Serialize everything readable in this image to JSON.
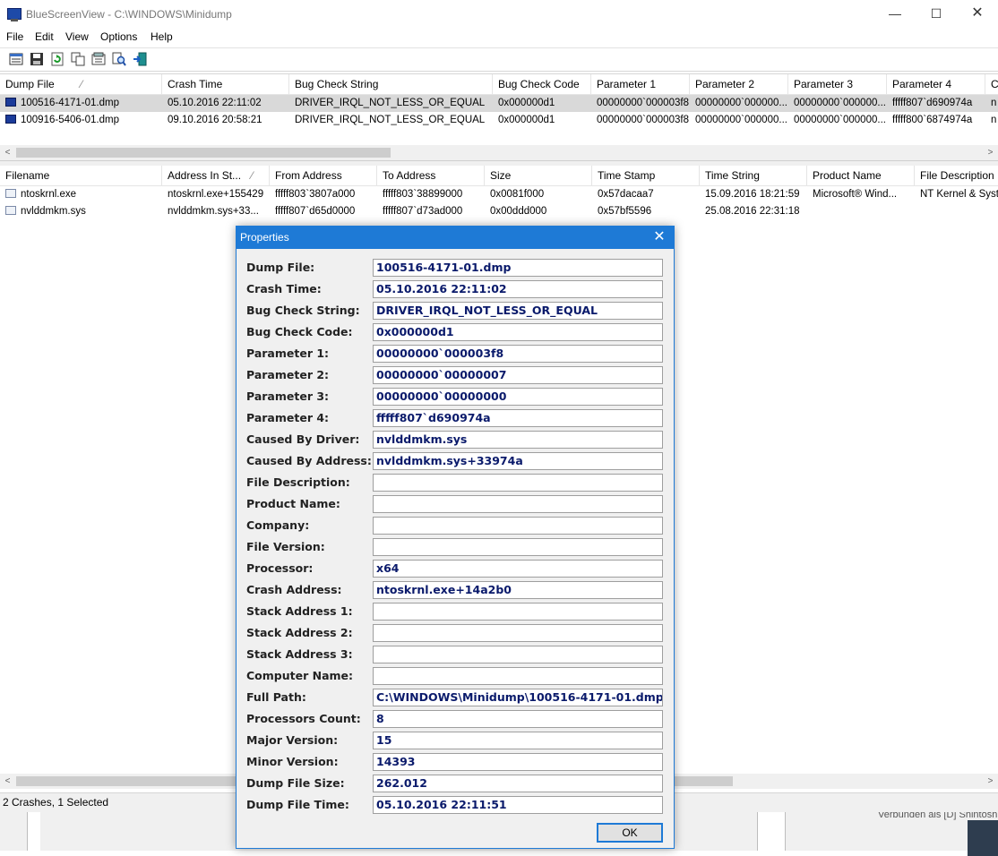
{
  "window": {
    "title": "BlueScreenView  -  C:\\WINDOWS\\Minidump",
    "controls": {
      "minimize": "—",
      "maximize": "☐",
      "close": "✕"
    }
  },
  "menu": [
    "File",
    "Edit",
    "View",
    "Options",
    "Help"
  ],
  "toolbar": {
    "icons": [
      "properties-icon",
      "save-icon",
      "refresh-icon",
      "copy-icon",
      "html-report-icon",
      "find-icon",
      "exit-icon"
    ]
  },
  "upper_list": {
    "columns": [
      "Dump File",
      "Crash Time",
      "Bug Check String",
      "Bug Check Code",
      "Parameter 1",
      "Parameter 2",
      "Parameter 3",
      "Parameter 4",
      "C"
    ],
    "sort_indicator": "⁄",
    "rows": [
      [
        "100516-4171-01.dmp",
        "05.10.2016 22:11:02",
        "DRIVER_IRQL_NOT_LESS_OR_EQUAL",
        "0x000000d1",
        "00000000`000003f8",
        "00000000`000000...",
        "00000000`000000...",
        "fffff807`d690974a",
        "n"
      ],
      [
        "100916-5406-01.dmp",
        "09.10.2016 20:58:21",
        "DRIVER_IRQL_NOT_LESS_OR_EQUAL",
        "0x000000d1",
        "00000000`000003f8",
        "00000000`000000...",
        "00000000`000000...",
        "fffff800`6874974a",
        "n"
      ]
    ]
  },
  "lower_list": {
    "columns": [
      "Filename",
      "Address In St...",
      "From Address",
      "To Address",
      "Size",
      "Time Stamp",
      "Time String",
      "Product Name",
      "File Description"
    ],
    "sort_indicator": "⁄",
    "rows": [
      [
        "ntoskrnl.exe",
        "ntoskrnl.exe+155429",
        "fffff803`3807a000",
        "fffff803`38899000",
        "0x0081f000",
        "0x57dacaa7",
        "15.09.2016 18:21:59",
        "Microsoft® Wind...",
        "NT Kernel & Syst"
      ],
      [
        "nvlddmkm.sys",
        "nvlddmkm.sys+33...",
        "fffff807`d65d0000",
        "fffff807`d73ad000",
        "0x00ddd000",
        "0x57bf5596",
        "25.08.2016 22:31:18",
        "",
        ""
      ]
    ]
  },
  "status": {
    "text": "2 Crashes, 1 Selected"
  },
  "background": {
    "partial_text": "Verbunden als [D] Shintosh"
  },
  "scroll": {
    "left_arrow": "<",
    "right_arrow": ">"
  },
  "dialog": {
    "title": "Properties",
    "close": "✕",
    "ok_label": "OK",
    "fields": [
      {
        "label": "Dump File:",
        "value": "100516-4171-01.dmp"
      },
      {
        "label": "Crash Time:",
        "value": "05.10.2016 22:11:02"
      },
      {
        "label": "Bug Check String:",
        "value": "DRIVER_IRQL_NOT_LESS_OR_EQUAL"
      },
      {
        "label": "Bug Check Code:",
        "value": "0x000000d1"
      },
      {
        "label": "Parameter 1:",
        "value": "00000000`000003f8"
      },
      {
        "label": "Parameter 2:",
        "value": "00000000`00000007"
      },
      {
        "label": "Parameter 3:",
        "value": "00000000`00000000"
      },
      {
        "label": "Parameter 4:",
        "value": "fffff807`d690974a"
      },
      {
        "label": "Caused By Driver:",
        "value": "nvlddmkm.sys"
      },
      {
        "label": "Caused By Address:",
        "value": "nvlddmkm.sys+33974a"
      },
      {
        "label": "File Description:",
        "value": ""
      },
      {
        "label": "Product Name:",
        "value": ""
      },
      {
        "label": "Company:",
        "value": ""
      },
      {
        "label": "File Version:",
        "value": ""
      },
      {
        "label": "Processor:",
        "value": "x64"
      },
      {
        "label": "Crash Address:",
        "value": "ntoskrnl.exe+14a2b0"
      },
      {
        "label": "Stack Address 1:",
        "value": ""
      },
      {
        "label": "Stack Address 2:",
        "value": ""
      },
      {
        "label": "Stack Address 3:",
        "value": ""
      },
      {
        "label": "Computer Name:",
        "value": ""
      },
      {
        "label": "Full Path:",
        "value": "C:\\WINDOWS\\Minidump\\100516-4171-01.dmp"
      },
      {
        "label": "Processors Count:",
        "value": "8"
      },
      {
        "label": "Major Version:",
        "value": "15"
      },
      {
        "label": "Minor Version:",
        "value": "14393"
      },
      {
        "label": "Dump File Size:",
        "value": "262.012"
      },
      {
        "label": "Dump File Time:",
        "value": "05.10.2016 22:11:51"
      }
    ]
  },
  "colors": {
    "accent": "#1e7ad6",
    "selected_row": "#d9d9d9",
    "value_text": "#0a1a6b"
  }
}
